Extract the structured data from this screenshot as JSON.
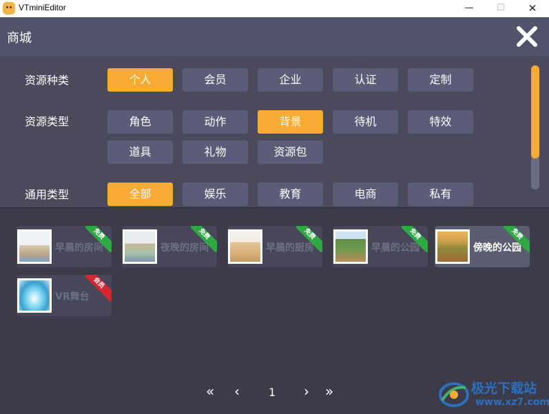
{
  "window": {
    "title": "VTminiEditor",
    "min": "—",
    "max": "☐",
    "close": "✕"
  },
  "header": {
    "title": "商城",
    "close_icon": "close-icon"
  },
  "filters": {
    "resource_kind": {
      "label": "资源种类",
      "options": [
        "个人",
        "会员",
        "企业",
        "认证",
        "定制"
      ],
      "selected": "个人"
    },
    "resource_type": {
      "label": "资源类型",
      "options": [
        "角色",
        "动作",
        "背景",
        "待机",
        "特效",
        "道具",
        "礼物",
        "资源包"
      ],
      "selected": "背景"
    },
    "general_type": {
      "label": "通用类型",
      "options": [
        "全部",
        "娱乐",
        "教育",
        "电商",
        "私有"
      ],
      "selected": "全部"
    }
  },
  "cards": [
    {
      "name": "早晨的房间",
      "badge": "免费",
      "badge_color": "#2ea843"
    },
    {
      "name": "夜晚的房间",
      "badge": "免费",
      "badge_color": "#2ea843"
    },
    {
      "name": "早晨的厨房",
      "badge": "免费",
      "badge_color": "#2ea843"
    },
    {
      "name": "早晨的公园",
      "badge": "免费",
      "badge_color": "#2ea843"
    },
    {
      "name": "傍晚的公园",
      "badge": "免费",
      "badge_color": "#2ea843"
    },
    {
      "name": "VR舞台",
      "badge": "会员",
      "badge_color": "#d82530"
    }
  ],
  "pagination": {
    "first": "«",
    "prev": "‹",
    "page": "1",
    "next": "›",
    "last": "»"
  },
  "watermark": {
    "name": "极光下载站",
    "url": "www.xz7.com"
  },
  "colors": {
    "accent": "#f8aa33",
    "chip": "#5b5d78",
    "header": "#52526a",
    "panel": "#4a4a5c",
    "free": "#2ea843",
    "member": "#d82530"
  }
}
